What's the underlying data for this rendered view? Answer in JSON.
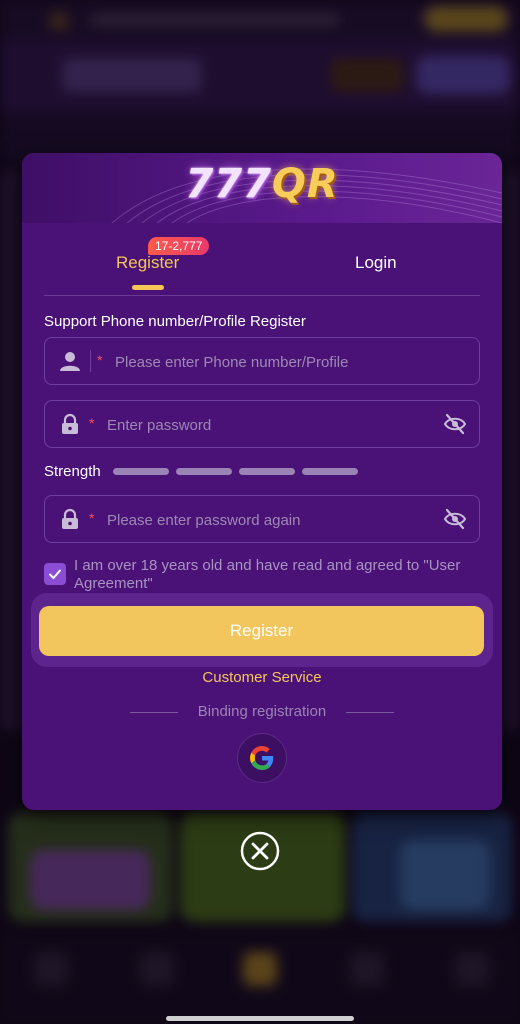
{
  "modal": {
    "logo_text": "777",
    "logo_accent": "QR",
    "tabs": {
      "register_label": "Register",
      "register_badge": "17-2,777",
      "login_label": "Login"
    },
    "form": {
      "section_label": "Support Phone number/Profile Register",
      "phone_placeholder": "Please enter Phone number/Profile",
      "phone_value": "",
      "password_placeholder": "Enter password",
      "password_value": "",
      "strength_label": "Strength",
      "strength_segments": 4,
      "confirm_placeholder": "Please enter password again",
      "confirm_value": "",
      "required_mark": "*",
      "agreement_text": "I am over 18 years old and have read and agreed to \"User Agreement\"",
      "agreement_checked": true,
      "register_button": "Register",
      "customer_service": "Customer Service",
      "binding_label": "Binding registration"
    }
  },
  "icons": {
    "user": "user-icon",
    "lock": "lock-icon",
    "eye_off": "eye-off-icon",
    "checkbox": "check-icon",
    "google": "google-icon",
    "close": "close-icon"
  },
  "colors": {
    "modal_bg": "#4a1276",
    "accent_gold": "#f5c656",
    "register_button": "#f2c65c",
    "badge": "#ff5a4a",
    "checkbox": "#8a4dd4",
    "required": "#ff4d5a"
  }
}
